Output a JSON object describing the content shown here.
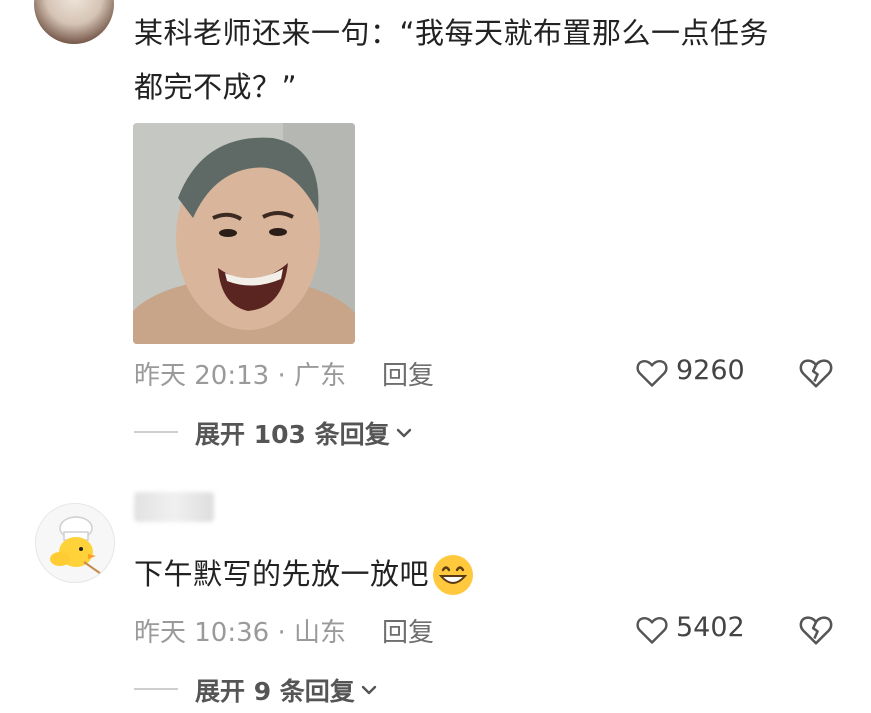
{
  "comments": [
    {
      "text_line1": "某科老师还来一句：“我每天就布置那么一点任务",
      "text_line2": "都完不成？”",
      "meta": "昨天 20:13 · 广东",
      "reply_label": "回复",
      "likes": "9260",
      "expand_label": "展开 103 条回复",
      "has_image": true
    },
    {
      "text": "下午默写的先放一放吧",
      "emoji": "grinning-face-emoji",
      "meta": "昨天 10:36 · 山东",
      "reply_label": "回复",
      "likes": "5402",
      "expand_label": "展开 9 条回复"
    }
  ],
  "icons": {
    "like": "heart-outline-icon",
    "dislike": "broken-heart-icon",
    "expand": "chevron-down-icon"
  },
  "colors": {
    "text": "#222222",
    "meta": "#9a9a9a",
    "emoji_face": "#ffc83d"
  }
}
